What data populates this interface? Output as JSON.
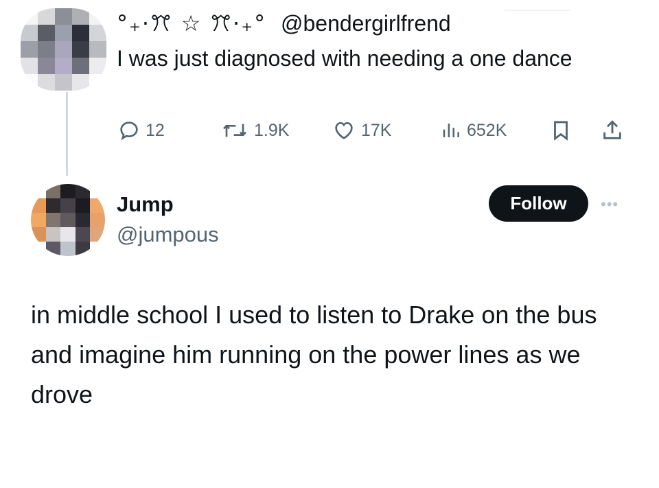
{
  "parent_tweet": {
    "display_name_deco": "°₊·ꔫ ☆ ꔫ·₊°",
    "handle": "@bendergirlfrend",
    "text": "I was just diagnosed with needing a one dance",
    "metrics": {
      "replies": "12",
      "retweets": "1.9K",
      "likes": "17K",
      "views": "652K"
    }
  },
  "reply_tweet": {
    "name": "Jump",
    "handle": "@jumpous",
    "follow_label": "Follow",
    "text": "in middle school I used to listen to Drake on the bus and imagine him running on the power lines as we drove"
  },
  "icons": [
    "reply-icon",
    "retweet-icon",
    "like-icon",
    "views-icon",
    "bookmark-icon",
    "share-icon",
    "more-icon"
  ],
  "colors": {
    "text": "#0f1419",
    "muted": "#536471",
    "follow_bg": "#0f1419",
    "thread_line": "#cfd9de"
  }
}
